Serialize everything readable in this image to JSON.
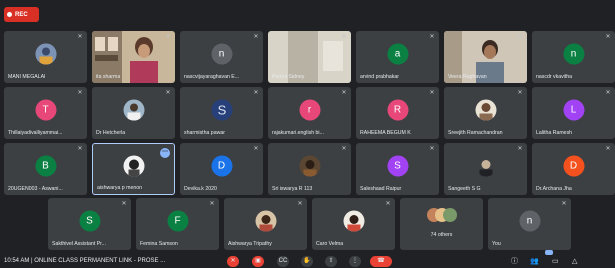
{
  "recording": {
    "label": "REC"
  },
  "participants": [
    {
      "name": "MANI MEGALAI",
      "avatar_color": "#3c4043"
    },
    {
      "name": "ita sharma",
      "avatar_color": "#3c4043"
    },
    {
      "name": "nascvijayaraghavan E...",
      "initial": "n",
      "avatar_color": "#5f6368"
    },
    {
      "name": "Poorni Sidney",
      "avatar_color": "#3c4043"
    },
    {
      "name": "arvind prabhakar",
      "initial": "a",
      "avatar_color": "#0b8043"
    },
    {
      "name": "Veera Raghavan",
      "avatar_color": "#3c4043"
    },
    {
      "name": "nascdr vkavitha",
      "initial": "n",
      "avatar_color": "#0b8043"
    },
    {
      "name": "Thillaiyadivalliyammai...",
      "initial": "T",
      "avatar_color": "#e8477a"
    },
    {
      "name": "Dr Hetcherla",
      "avatar_color": "#3c4043"
    },
    {
      "name": "sharmistha pawar",
      "initial": "S",
      "avatar_color": "#3c4043"
    },
    {
      "name": "rajakumari.english bi...",
      "initial": "r",
      "avatar_color": "#e8477a"
    },
    {
      "name": "RAHEEMA BEGUM K",
      "initial": "R",
      "avatar_color": "#e8477a"
    },
    {
      "name": "Sreejith Ramachandran",
      "avatar_color": "#3c4043"
    },
    {
      "name": "Lalitha Ramesh",
      "initial": "L",
      "avatar_color": "#a142f4"
    },
    {
      "name": "20UGEN003 - Aswani...",
      "initial": "B",
      "avatar_color": "#0b8043"
    },
    {
      "name": "aishwarya p menon",
      "avatar_color": "#3c4043"
    },
    {
      "name": "Devika.k 2020",
      "initial": "D",
      "avatar_color": "#1a73e8"
    },
    {
      "name": "Sri iswarya R 113",
      "avatar_color": "#3c4043"
    },
    {
      "name": "Saleshaad Raipur",
      "initial": "S",
      "avatar_color": "#a142f4"
    },
    {
      "name": "Sangeeth S G",
      "avatar_color": "#3c4043"
    },
    {
      "name": "Dr.Archana Jha",
      "initial": "D",
      "avatar_color": "#f4511e"
    },
    {
      "name": "Sakthivel Assistant Pr...",
      "initial": "S",
      "avatar_color": "#0b8043"
    },
    {
      "name": "Femina Samson",
      "initial": "F",
      "avatar_color": "#0b8043"
    },
    {
      "name": "Aishwarya Tripathy",
      "avatar_color": "#3c4043"
    },
    {
      "name": "Caro Velma",
      "avatar_color": "#3c4043"
    },
    {
      "name": "74 others",
      "avatar_color": "#3c4043"
    },
    {
      "name": "You",
      "initial": "n",
      "avatar_color": "#5f6368"
    }
  ],
  "bottom_bar": {
    "time": "10:54 AM",
    "meeting_title": "ONLINE CLASS PERMANENT LINK - PROSE ...",
    "controls": [
      "mic-off-icon",
      "camera-off-icon",
      "captions-icon",
      "raise-hand-icon",
      "present-icon",
      "more-options-icon",
      "end-call-icon"
    ],
    "right_icons": [
      "info-icon",
      "people-icon",
      "chat-icon",
      "activities-icon"
    ]
  }
}
